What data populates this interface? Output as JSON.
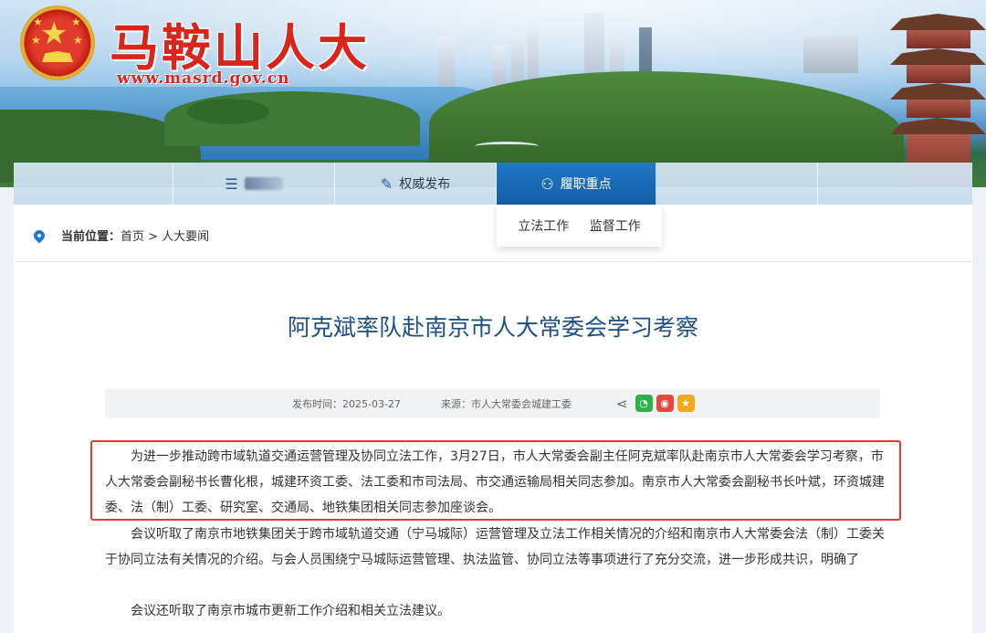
{
  "header": {
    "site_title": "马鞍山人大",
    "site_url": "www.masrd.gov.cn"
  },
  "nav": {
    "items": [
      {
        "label": ""
      },
      {
        "label": "",
        "blurred": true,
        "icon": "list-icon"
      },
      {
        "label": "权威发布",
        "icon": "edit-document-icon"
      },
      {
        "label": "履职重点",
        "icon": "people-icon",
        "active": true
      },
      {
        "label": ""
      },
      {
        "label": ""
      }
    ],
    "dropdown": [
      "立法工作",
      "监督工作"
    ]
  },
  "breadcrumb": {
    "label": "当前位置：",
    "path": "首页 > 人大要闻"
  },
  "article": {
    "title": "阿克斌率队赴南京市人大常委会学习考察",
    "publish_time": "发布时间：2025-03-27",
    "source": "来源：市人大常委会城建工委",
    "share_icons": [
      "share-icon",
      "wechat-icon",
      "weibo-icon",
      "favorite-icon"
    ],
    "paragraphs": [
      "为进一步推动跨市域轨道交通运营管理及协同立法工作，3月27日，市人大常委会副主任阿克斌率队赴南京市人大常委会学习考察，市人大常委会副秘书长曹化根，城建环资工委、法工委和市司法局、市交通运输局相关同志参加。南京市人大常委会副秘书长叶斌，环资城建委、法（制）工委、研究室、交通局、地铁集团相关同志参加座谈会。",
      "会议听取了南京市地铁集团关于跨市域轨道交通（宁马城际）运营管理及立法工作相关情况的介绍和南京市人大常委会法（制）工委关于协同立法有关情况的介绍。与会人员围绕宁马城际运营管理、执法监管、协同立法等事项进行了充分交流，进一步形成共识，明确了",
      "会议还听取了南京市城市更新工作介绍和相关立法建议。"
    ]
  },
  "colors": {
    "accent_blue": "#1f78c8",
    "title_blue": "#1c4f86",
    "brand_red": "#d9251c",
    "highlight_red": "#e23c2c"
  }
}
